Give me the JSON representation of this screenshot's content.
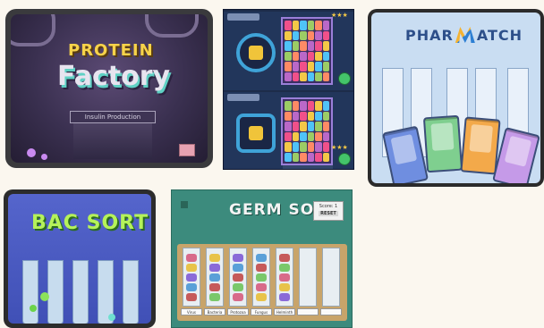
{
  "tiles": [
    {
      "id": "protein-factory",
      "title_top": "PROTEIN",
      "title_main": "Factory",
      "subtitle": "Insulin Production"
    },
    {
      "id": "match-puzzle",
      "stars": "★★★",
      "gem_colors": [
        "#f0508a",
        "#f3c847",
        "#4fc3f7",
        "#9ccc65",
        "#ff8a65",
        "#ba68c8"
      ]
    },
    {
      "id": "pharma-match",
      "logo_left": "PHAR",
      "logo_right": "ATCH",
      "cards": [
        "",
        "",
        "",
        ""
      ]
    },
    {
      "id": "bac-sort",
      "title": "BAC SORT"
    },
    {
      "id": "germ-sort",
      "title": "GERM SORT",
      "score_label": "Score: 1",
      "reset_label": "RESET",
      "labels": [
        "Virus",
        "Bacteria",
        "Protozoa",
        "Fungus",
        "Helminth",
        "",
        ""
      ]
    }
  ],
  "colors": {
    "page_bg": "#fbf7ef",
    "protein_yellow": "#f7d34a",
    "bac_green": "#b5f25a",
    "pharma_blue": "#c9ddf2",
    "germ_teal": "#3c8b7d"
  }
}
